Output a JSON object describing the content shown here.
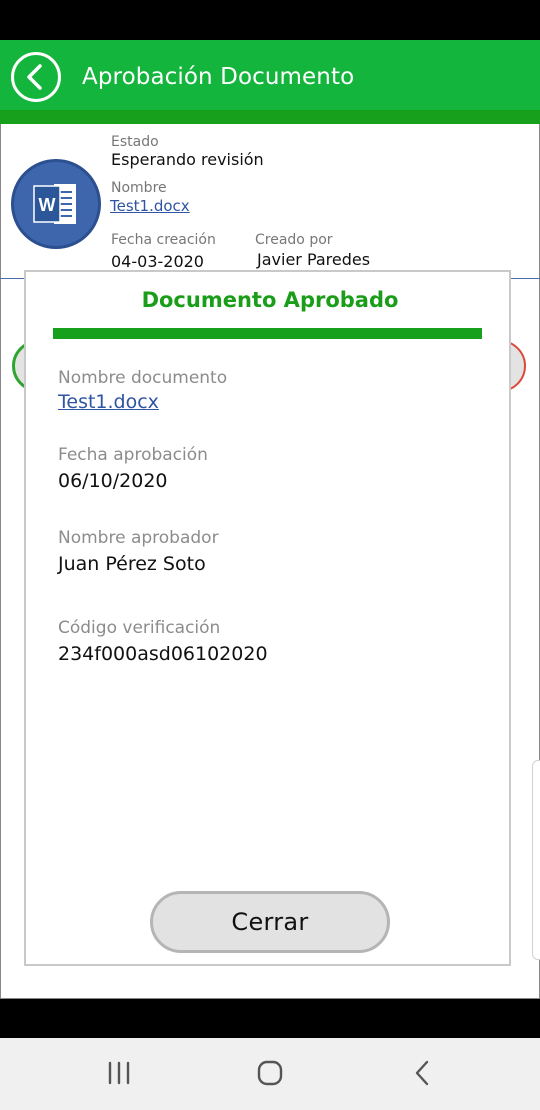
{
  "header": {
    "title": "Aprobación Documento",
    "back_icon": "chevron-left-icon",
    "color": "#13b53c"
  },
  "document": {
    "icon": "word-document-icon",
    "estado_label": "Estado",
    "estado_value": "Esperando revisión",
    "nombre_label": "Nombre",
    "nombre_value": "Test1.docx",
    "fecha_creacion_label": "Fecha creación",
    "fecha_creacion_value": "04-03-2020",
    "creado_por_label": "Creado por",
    "creado_por_value": "Javier Paredes"
  },
  "modal": {
    "title": "Documento Aprobado",
    "accent_color": "#17a01c",
    "fields": [
      {
        "label": "Nombre documento",
        "value": "Test1.docx"
      },
      {
        "label": "Fecha aprobación",
        "value": "06/10/2020"
      },
      {
        "label": "Nombre aprobador",
        "value": "Juan Pérez Soto"
      },
      {
        "label": "Código verificación",
        "value": "234f000asd06102020"
      }
    ],
    "close_label": "Cerrar"
  },
  "nav": {
    "recents_icon": "recent-apps-icon",
    "home_icon": "home-icon",
    "back_icon": "nav-back-icon"
  }
}
